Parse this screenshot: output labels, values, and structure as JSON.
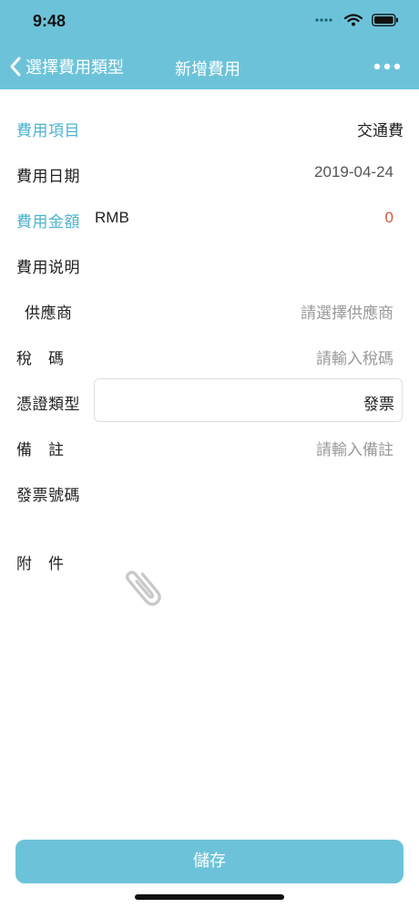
{
  "status_bar": {
    "time": "9:48"
  },
  "nav": {
    "back_label": "選擇費用類型",
    "title": "新增費用"
  },
  "form": {
    "expense_item": {
      "label": "費用項目",
      "value": "交通費"
    },
    "expense_date": {
      "label": "費用日期",
      "value": "2019-04-24"
    },
    "expense_amount": {
      "label": "費用金額",
      "currency": "RMB",
      "value": "0"
    },
    "expense_desc": {
      "label": "費用说明"
    },
    "supplier": {
      "label": "供應商",
      "placeholder": "請選擇供應商"
    },
    "tax_code": {
      "label": "稅　碼",
      "placeholder": "請輸入稅碼"
    },
    "voucher_type": {
      "label": "憑證類型",
      "value": "發票"
    },
    "remark": {
      "label": "備　註",
      "placeholder": "請輸入備註"
    },
    "invoice_no": {
      "label": "發票號碼"
    },
    "attachment": {
      "label": "附　件"
    }
  },
  "footer": {
    "save_label": "儲存"
  },
  "colors": {
    "accent": "#6cc3d9",
    "label_accent": "#4fb3cf",
    "amount_red": "#d0573a"
  }
}
